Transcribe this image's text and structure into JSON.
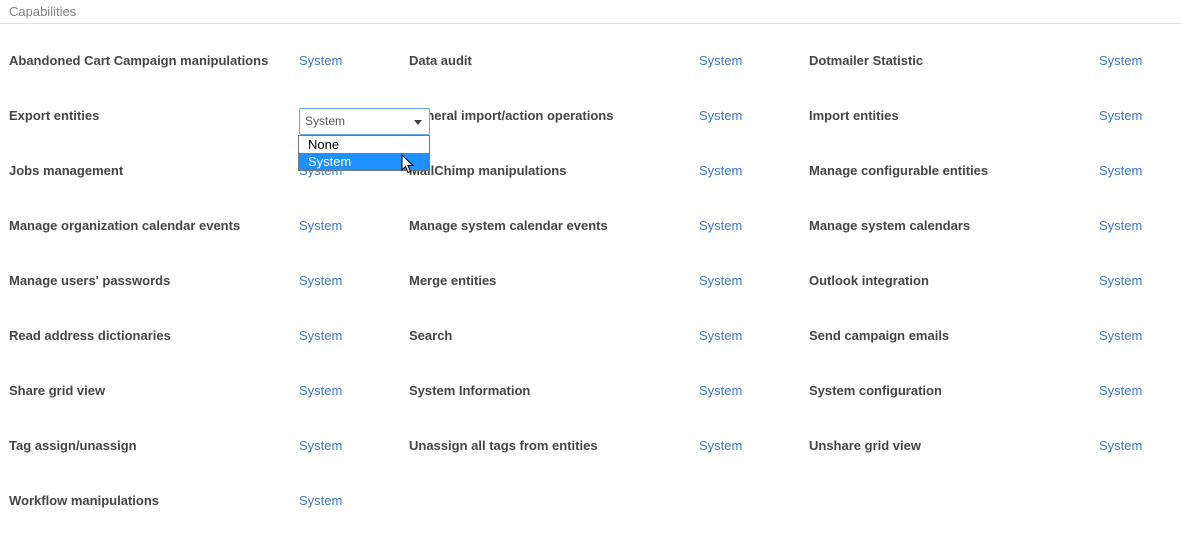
{
  "section": {
    "title": "Capabilities"
  },
  "capabilities": [
    {
      "label": "Abandoned Cart Campaign manipulations",
      "value": "System"
    },
    {
      "label": "Data audit",
      "value": "System"
    },
    {
      "label": "Dotmailer Statistic",
      "value": "System"
    },
    {
      "label": "Export entities",
      "value": "System"
    },
    {
      "label": "General import/action operations",
      "value": "System"
    },
    {
      "label": "Import entities",
      "value": "System"
    },
    {
      "label": "Jobs management",
      "value": "System"
    },
    {
      "label": "MailChimp manipulations",
      "value": "System"
    },
    {
      "label": "Manage configurable entities",
      "value": "System"
    },
    {
      "label": "Manage organization calendar events",
      "value": "System"
    },
    {
      "label": "Manage system calendar events",
      "value": "System"
    },
    {
      "label": "Manage system calendars",
      "value": "System"
    },
    {
      "label": "Manage users' passwords",
      "value": "System"
    },
    {
      "label": "Merge entities",
      "value": "System"
    },
    {
      "label": "Outlook integration",
      "value": "System"
    },
    {
      "label": "Read address dictionaries",
      "value": "System"
    },
    {
      "label": "Search",
      "value": "System"
    },
    {
      "label": "Send campaign emails",
      "value": "System"
    },
    {
      "label": "Share grid view",
      "value": "System"
    },
    {
      "label": "System Information",
      "value": "System"
    },
    {
      "label": "System configuration",
      "value": "System"
    },
    {
      "label": "Tag assign/unassign",
      "value": "System"
    },
    {
      "label": "Unassign all tags from entities",
      "value": "System"
    },
    {
      "label": "Unshare grid view",
      "value": "System"
    },
    {
      "label": "Workflow manipulations",
      "value": "System"
    }
  ],
  "dropdown": {
    "selected": "System",
    "options": [
      "None",
      "System"
    ],
    "highlighted": "System"
  },
  "colors": {
    "link": "#3a78c2",
    "highlight": "#1e90ff"
  }
}
